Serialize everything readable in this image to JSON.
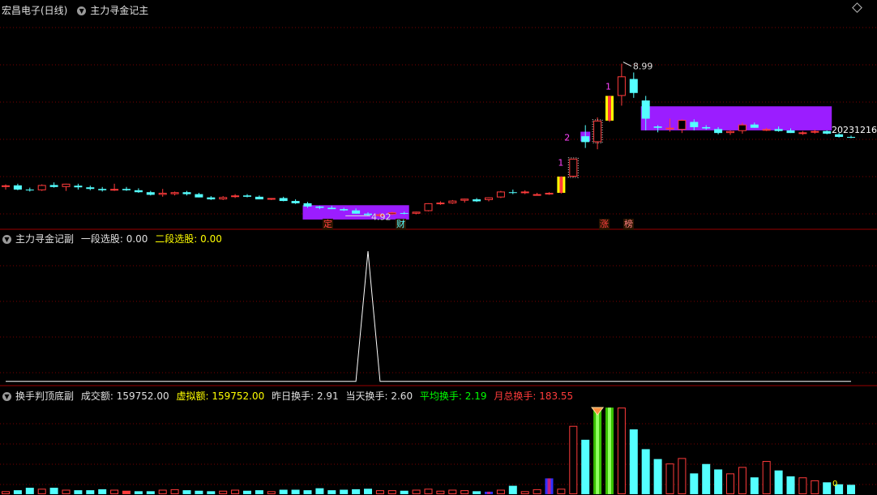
{
  "colors": {
    "up": "#ff3b3b",
    "down": "#54ffff",
    "grid": "#7a0000",
    "sep": "#9a0000",
    "band": "#9b1dff",
    "yellow": "#ffff00",
    "green": "#00ff00",
    "white": "#ffffff"
  },
  "header_main": {
    "stock": "宏昌电子(日线)",
    "indicator": "主力寻金记主",
    "menu_icon": "diamond-icon"
  },
  "header_sub1": {
    "indicator": "主力寻金记副",
    "label_1": "一段选股:",
    "value_1": "0.00",
    "label_2": "二段选股:",
    "value_2": "0.00"
  },
  "header_sub2": {
    "indicator": "换手判顶底副",
    "amount_label": "成交额:",
    "amount_value": "159752.00",
    "virtual_label": "虚拟额:",
    "virtual_value": "159752.00",
    "yesterday_label": "昨日换手:",
    "yesterday_value": "2.91",
    "today_label": "当天换手:",
    "today_value": "2.60",
    "avg_label": "平均换手:",
    "avg_value": "2.19",
    "monthly_label": "月总换手:",
    "monthly_value": "183.55"
  },
  "annotations": {
    "high_label": "8.99",
    "low_label": "4.92",
    "date_label": "20231216",
    "seq_1a": "1",
    "seq_1b": "1",
    "seq_2": "2",
    "tag_ding": "定",
    "tag_cai": "财",
    "tag_zhang": "涨",
    "tag_bang": "榜",
    "sub2_marker": "0"
  },
  "chart_data": [
    {
      "type": "candlestick",
      "title": "主力寻金记主",
      "series": [
        {
          "name": "candles",
          "ohlc": [
            [
              5.22,
              5.28,
              5.12,
              5.25
            ],
            [
              5.25,
              5.3,
              5.1,
              5.12
            ],
            [
              5.12,
              5.18,
              5.06,
              5.1
            ],
            [
              5.1,
              5.28,
              5.08,
              5.26
            ],
            [
              5.26,
              5.34,
              5.18,
              5.2
            ],
            [
              5.2,
              5.3,
              5.08,
              5.3
            ],
            [
              5.24,
              5.3,
              5.12,
              5.19
            ],
            [
              5.19,
              5.24,
              5.1,
              5.14
            ],
            [
              5.14,
              5.2,
              5.06,
              5.1
            ],
            [
              5.12,
              5.3,
              5.08,
              5.14
            ],
            [
              5.14,
              5.2,
              5.08,
              5.1
            ],
            [
              5.1,
              5.16,
              5.02,
              5.04
            ],
            [
              5.04,
              5.08,
              4.94,
              4.96
            ],
            [
              4.96,
              5.14,
              4.9,
              5.02
            ],
            [
              4.98,
              5.06,
              4.94,
              5.04
            ],
            [
              5.04,
              5.08,
              4.94,
              4.98
            ],
            [
              4.98,
              5.02,
              4.88,
              4.88
            ],
            [
              4.88,
              4.92,
              4.8,
              4.82
            ],
            [
              4.82,
              4.92,
              4.8,
              4.89
            ],
            [
              4.89,
              4.98,
              4.86,
              4.94
            ],
            [
              4.94,
              4.98,
              4.88,
              4.9
            ],
            [
              4.9,
              4.94,
              4.82,
              4.82
            ],
            [
              4.82,
              4.86,
              4.8,
              4.86
            ],
            [
              4.86,
              4.9,
              4.76,
              4.77
            ],
            [
              4.77,
              4.82,
              4.68,
              4.7
            ],
            [
              4.7,
              4.74,
              4.56,
              4.6
            ],
            [
              4.6,
              4.62,
              4.52,
              4.56
            ],
            [
              4.56,
              4.62,
              4.52,
              4.52
            ],
            [
              4.52,
              4.56,
              4.46,
              4.48
            ],
            [
              4.48,
              4.54,
              4.38,
              4.38
            ],
            [
              4.38,
              4.42,
              4.32,
              4.34
            ],
            [
              4.34,
              4.4,
              4.28,
              4.36
            ],
            [
              4.36,
              4.44,
              4.34,
              4.42
            ],
            [
              4.4,
              4.44,
              4.36,
              4.38
            ],
            [
              4.38,
              4.44,
              4.36,
              4.44
            ],
            [
              4.46,
              4.7,
              4.45,
              4.7
            ],
            [
              4.7,
              4.76,
              4.65,
              4.72
            ],
            [
              4.7,
              4.8,
              4.68,
              4.78
            ],
            [
              4.78,
              4.84,
              4.72,
              4.84
            ],
            [
              4.82,
              4.86,
              4.74,
              4.76
            ],
            [
              4.8,
              4.88,
              4.76,
              4.88
            ],
            [
              4.88,
              5.08,
              4.86,
              5.06
            ],
            [
              5.04,
              5.12,
              4.98,
              5.02
            ],
            [
              5.04,
              5.1,
              4.98,
              5.06
            ],
            [
              4.98,
              5.02,
              4.94,
              4.98
            ],
            [
              5.0,
              5.04,
              4.96,
              5.02
            ],
            [
              5.02,
              5.52,
              5.0,
              5.52
            ],
            [
              5.52,
              6.07,
              5.5,
              6.07
            ],
            [
              6.76,
              7.1,
              6.4,
              6.58
            ],
            [
              6.58,
              7.34,
              6.36,
              7.24
            ],
            [
              7.24,
              8.0,
              7.2,
              8.0
            ],
            [
              8.0,
              8.99,
              7.7,
              8.6
            ],
            [
              8.52,
              8.72,
              7.94,
              8.09
            ],
            [
              7.86,
              8.0,
              6.94,
              7.3
            ],
            [
              7.06,
              7.1,
              6.88,
              7.02
            ],
            [
              7.02,
              7.3,
              6.9,
              7.02
            ],
            [
              6.96,
              7.28,
              6.86,
              7.26
            ],
            [
              7.2,
              7.28,
              6.94,
              7.04
            ],
            [
              7.04,
              7.1,
              6.96,
              7.0
            ],
            [
              6.98,
              7.04,
              6.82,
              6.86
            ],
            [
              6.86,
              6.94,
              6.8,
              6.92
            ],
            [
              6.92,
              7.18,
              6.84,
              7.12
            ],
            [
              7.12,
              7.18,
              7.02,
              7.02
            ],
            [
              6.98,
              7.02,
              6.92,
              6.98
            ],
            [
              6.98,
              7.06,
              6.9,
              6.92
            ],
            [
              6.94,
              7.0,
              6.86,
              6.86
            ],
            [
              6.86,
              6.92,
              6.8,
              6.88
            ],
            [
              6.88,
              6.96,
              6.84,
              6.92
            ],
            [
              6.92,
              6.94,
              6.82,
              6.84
            ],
            [
              6.82,
              6.86,
              6.72,
              6.74
            ],
            [
              6.74,
              6.78,
              6.7,
              6.72
            ]
          ]
        }
      ],
      "signal_days": [
        46,
        50
      ],
      "bands": [
        {
          "from": 25,
          "to": 33,
          "top": 4.64,
          "bottom": 4.2
        },
        {
          "from": 53,
          "to": 68,
          "top": 7.68,
          "bottom": 6.94
        },
        {
          "from": 48,
          "to": 48,
          "top": 6.9,
          "bottom": 6.6
        }
      ],
      "ylim": [
        3.95,
        10.45
      ]
    },
    {
      "type": "line",
      "title": "主力寻金记副",
      "series": [
        {
          "name": "一段选股",
          "values": [
            0,
            0,
            0,
            0,
            0,
            0,
            0,
            0,
            0,
            0,
            0,
            0,
            0,
            0,
            0,
            0,
            0,
            0,
            0,
            0,
            0,
            0,
            0,
            0,
            0,
            0,
            0,
            0,
            0,
            0,
            1,
            0,
            0,
            0,
            0,
            0,
            0,
            0,
            0,
            0,
            0,
            0,
            0,
            0,
            0,
            0,
            0,
            0,
            0,
            0,
            0,
            0,
            0,
            0,
            0,
            0,
            0,
            0,
            0,
            0,
            0,
            0,
            0,
            0,
            0,
            0,
            0,
            0,
            0,
            0,
            0
          ]
        }
      ],
      "ylim": [
        -0.02,
        1.05
      ]
    },
    {
      "type": "bar",
      "title": "换手判顶底副",
      "series": [
        {
          "name": "换手",
          "values": [
            0.6,
            0.8,
            1.3,
            1.1,
            1.3,
            0.9,
            0.8,
            0.8,
            1.0,
            0.9,
            0.7,
            0.6,
            0.6,
            0.9,
            1.0,
            0.8,
            0.7,
            0.6,
            0.7,
            0.9,
            0.7,
            0.8,
            0.6,
            0.9,
            0.9,
            0.8,
            1.2,
            0.8,
            0.9,
            1.0,
            1.1,
            0.8,
            0.8,
            0.7,
            0.9,
            1.1,
            0.7,
            0.9,
            0.8,
            0.6,
            0.5,
            0.9,
            1.7,
            0.6,
            1.0,
            3.2,
            1.1,
            13.8,
            11.0,
            17.1,
            17.5,
            17.5,
            13.1,
            9.1,
            7.1,
            6.2,
            7.3,
            4.2,
            6.1,
            5.0,
            4.2,
            5.5,
            3.4,
            6.7,
            4.8,
            3.6,
            3.4,
            2.8,
            2.4,
            2.0,
            1.9
          ]
        },
        {
          "name": "标记",
          "values": [
            0,
            0,
            0,
            0,
            0,
            0,
            0,
            0,
            0,
            0,
            0,
            0,
            0,
            0,
            0,
            0,
            0,
            0,
            0,
            0,
            0,
            0,
            0,
            0,
            0,
            0,
            0,
            0,
            0,
            0,
            0,
            0,
            0,
            0,
            0,
            0,
            0,
            0,
            0,
            0,
            0,
            0,
            0,
            0,
            0,
            0,
            0,
            0,
            0,
            0,
            0,
            0,
            0,
            0,
            0,
            0,
            0,
            0,
            0,
            0,
            0,
            0,
            0,
            0,
            0,
            0,
            0,
            0,
            0,
            0,
            0
          ]
        }
      ],
      "ylim": [
        0,
        18.5
      ]
    }
  ]
}
